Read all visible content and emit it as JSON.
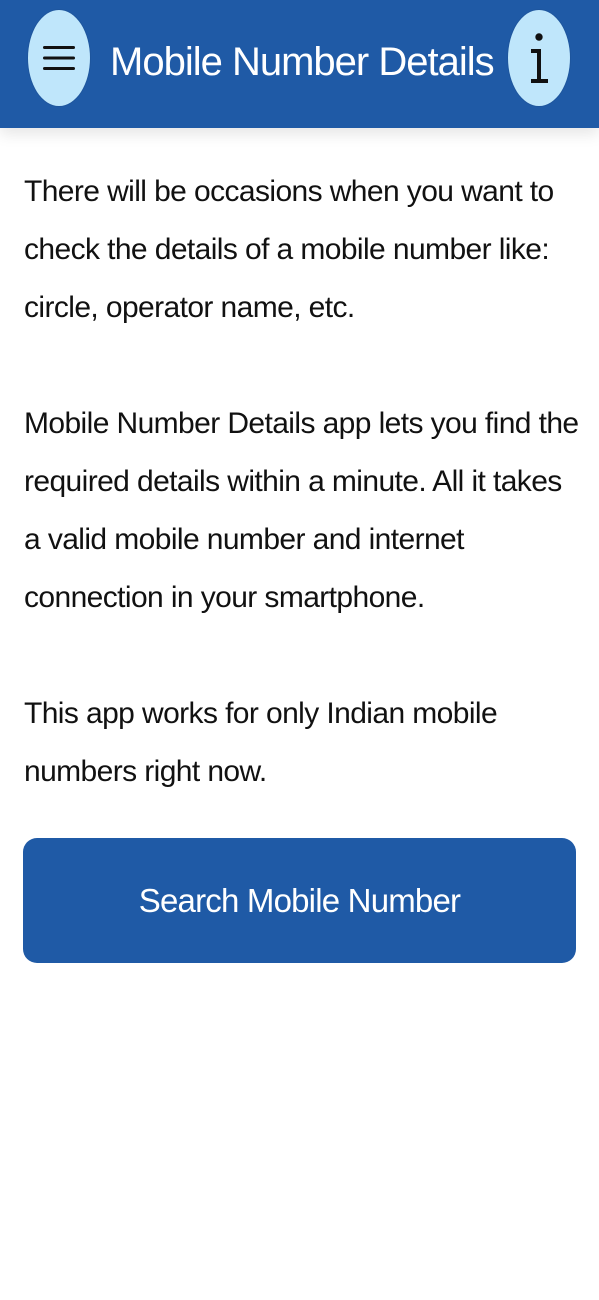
{
  "header": {
    "title": "Mobile Number Details",
    "menu_icon": "menu-icon",
    "info_icon": "info-icon"
  },
  "content": {
    "paragraphs": [
      "There will be occasions when you want to check the details of a mobile number like: circle, operator name, etc.",
      "Mobile Number Details app lets you find the required details within a minute. All it takes a valid mobile number and internet connection in your smartphone.",
      "This app works for only Indian mobile numbers right now."
    ]
  },
  "actions": {
    "search_label": "Search Mobile Number"
  },
  "colors": {
    "primary": "#1f5aa6",
    "icon_button_bg": "#bfe6fb",
    "text": "#111111",
    "background": "#ffffff"
  }
}
